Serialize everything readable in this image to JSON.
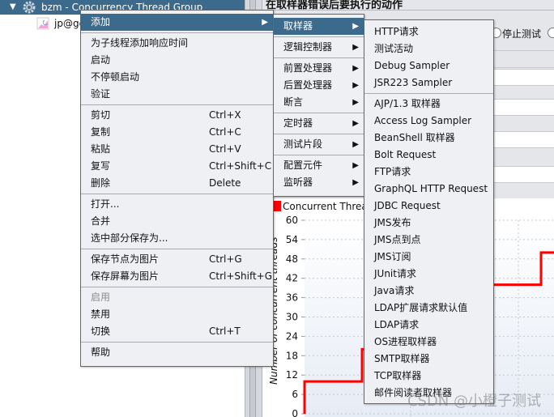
{
  "tree": {
    "items": [
      {
        "label": "bzm - Concurrency Thread Group",
        "icon": "gear-icon",
        "selected": true
      },
      {
        "label": "jp@gc",
        "icon": "graph-icon",
        "selected": false
      }
    ]
  },
  "right_panel": {
    "title": "在取样器错误后要执行的动作",
    "radio_stop_test": "停止测试"
  },
  "context_menu": {
    "items": [
      {
        "label": "添加",
        "submenu": true,
        "highlighted": true
      },
      {
        "sep": true
      },
      {
        "label": "为子线程添加响应时间"
      },
      {
        "label": "启动"
      },
      {
        "label": "不停顿启动"
      },
      {
        "label": "验证"
      },
      {
        "sep": true
      },
      {
        "label": "剪切",
        "shortcut": "Ctrl+X"
      },
      {
        "label": "复制",
        "shortcut": "Ctrl+C"
      },
      {
        "label": "粘贴",
        "shortcut": "Ctrl+V"
      },
      {
        "label": "复写",
        "shortcut": "Ctrl+Shift+C"
      },
      {
        "label": "删除",
        "shortcut": "Delete"
      },
      {
        "sep": true
      },
      {
        "label": "打开..."
      },
      {
        "label": "合并"
      },
      {
        "label": "选中部分保存为..."
      },
      {
        "sep": true
      },
      {
        "label": "保存节点为图片",
        "shortcut": "Ctrl+G"
      },
      {
        "label": "保存屏幕为图片",
        "shortcut": "Ctrl+Shift+G"
      },
      {
        "sep": true
      },
      {
        "label": "启用",
        "disabled": true
      },
      {
        "label": "禁用"
      },
      {
        "label": "切换",
        "shortcut": "Ctrl+T"
      },
      {
        "sep": true
      },
      {
        "label": "帮助"
      }
    ]
  },
  "add_submenu": {
    "items": [
      {
        "label": "取样器",
        "submenu": true,
        "highlighted": true
      },
      {
        "sep": true
      },
      {
        "label": "逻辑控制器",
        "submenu": true
      },
      {
        "sep": true
      },
      {
        "label": "前置处理器",
        "submenu": true
      },
      {
        "label": "后置处理器",
        "submenu": true
      },
      {
        "label": "断言",
        "submenu": true
      },
      {
        "sep": true
      },
      {
        "label": "定时器",
        "submenu": true
      },
      {
        "sep": true
      },
      {
        "label": "测试片段",
        "submenu": true
      },
      {
        "sep": true
      },
      {
        "label": "配置元件",
        "submenu": true
      },
      {
        "label": "监听器",
        "submenu": true
      }
    ]
  },
  "sampler_submenu": {
    "items": [
      {
        "label": "HTTP请求"
      },
      {
        "label": "测试活动"
      },
      {
        "label": "Debug Sampler"
      },
      {
        "label": "JSR223 Sampler"
      },
      {
        "sep": true
      },
      {
        "label": "AJP/1.3 取样器"
      },
      {
        "label": "Access Log Sampler"
      },
      {
        "label": "BeanShell 取样器"
      },
      {
        "label": "Bolt Request"
      },
      {
        "label": "FTP请求"
      },
      {
        "label": "GraphQL HTTP Request"
      },
      {
        "label": "JDBC Request"
      },
      {
        "label": "JMS发布"
      },
      {
        "label": "JMS点到点"
      },
      {
        "label": "JMS订阅"
      },
      {
        "label": "JUnit请求"
      },
      {
        "label": "Java请求"
      },
      {
        "label": "LDAP扩展请求默认值"
      },
      {
        "label": "LDAP请求"
      },
      {
        "label": "OS进程取样器"
      },
      {
        "label": "SMTP取样器"
      },
      {
        "label": "TCP取样器"
      },
      {
        "label": "邮件阅读者取样器"
      }
    ]
  },
  "chart_data": {
    "type": "line",
    "legend": [
      "Concurrent Threads"
    ],
    "legend_visible_text": "Concurrent Threac",
    "ylabel": "Number of concurrent threads",
    "yticks": [
      "0",
      "6",
      "12",
      "18",
      "24",
      "30",
      "36",
      "42",
      "48",
      "54",
      "60"
    ],
    "ylim": [
      0,
      60
    ],
    "grid": true,
    "line_style": "step",
    "series": [
      {
        "color": "#ff0000",
        "visible_levels": [
          10,
          20,
          40,
          50
        ]
      }
    ]
  },
  "watermark": "CSDN @小橙子测试",
  "colors": {
    "highlight": "#3b6a8c",
    "menu_bg": "#eef0f4",
    "series": "#ff0000"
  }
}
